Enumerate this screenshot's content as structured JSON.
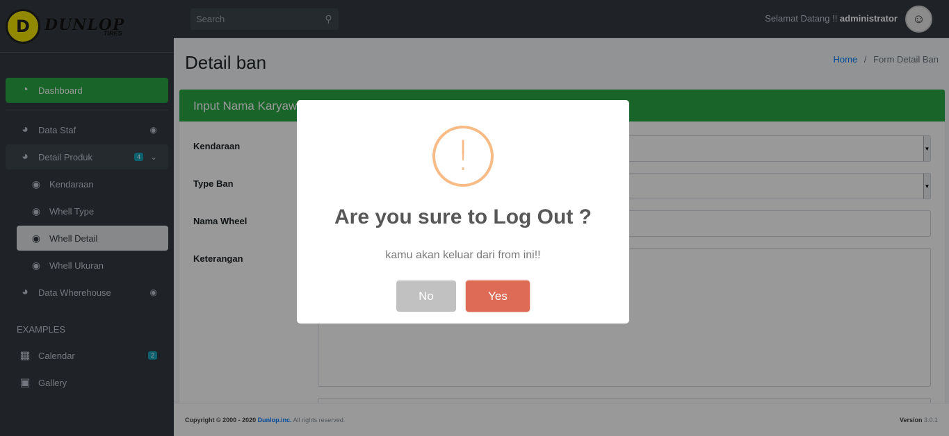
{
  "brand": {
    "logo_letter": "D",
    "name": "DUNLOP",
    "sub": "TIRES"
  },
  "sidebar": {
    "items": [
      {
        "label": "Dashboard"
      },
      {
        "label": "Data Staf"
      },
      {
        "label": "Detail Produk",
        "badge": "4"
      },
      {
        "label": "Data Wherehouse"
      }
    ],
    "sub_items": [
      {
        "label": "Kendaraan"
      },
      {
        "label": "Whell Type"
      },
      {
        "label": "Whell Detail"
      },
      {
        "label": "Whell Ukuran"
      }
    ],
    "examples_header": "EXAMPLES",
    "examples": [
      {
        "label": "Calendar",
        "badge": "2"
      },
      {
        "label": "Gallery"
      }
    ]
  },
  "topbar": {
    "search_placeholder": "Search",
    "welcome_prefix": "Selamat Datang !! ",
    "username": "administrator"
  },
  "page": {
    "title": "Detail ban",
    "breadcrumb_home": "Home",
    "breadcrumb_sep": "/",
    "breadcrumb_current": "Form Detail Ban",
    "card_title": "Input Nama Karyawan",
    "fields": [
      {
        "label": "Kendaraan"
      },
      {
        "label": "Type Ban"
      },
      {
        "label": "Nama Wheel"
      },
      {
        "label": "Keterangan"
      }
    ]
  },
  "footer": {
    "copyright_prefix": "Copyright © 2000 - 2020 ",
    "company": "Dunlop.inc.",
    "rights": " All rights reserved.",
    "version_label": "Version",
    "version": "3.0.1"
  },
  "modal": {
    "icon": "!",
    "title": "Are you sure to Log Out ?",
    "text": "kamu akan keluar dari from ini!!",
    "no_label": "No",
    "yes_label": "Yes"
  },
  "colors": {
    "accent": "#28a745",
    "warning": "#f8bb86",
    "confirm": "#dd6b55"
  }
}
